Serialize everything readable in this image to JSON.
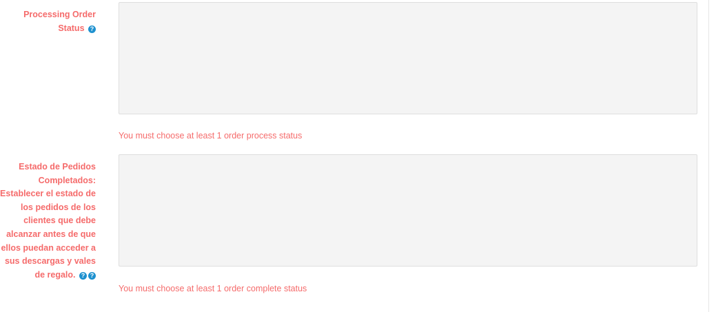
{
  "fields": [
    {
      "label": "Processing Order Status",
      "help_icon": "question-circle-icon",
      "error": "You must choose at least 1 order process status"
    },
    {
      "label": "Estado de Pedidos Completados: Establecer el estado de los pedidos de los clientes que debe alcanzar antes de que ellos puedan acceder a sus descargas y vales de regalo.",
      "help_icon": "question-circle-icon",
      "error": "You must choose at least 1 order complete status"
    }
  ],
  "colors": {
    "label_error": "#f56b6b",
    "help_icon_bg": "#1e91cf",
    "select_bg": "#f4f4f4",
    "select_border": "#dedede"
  }
}
